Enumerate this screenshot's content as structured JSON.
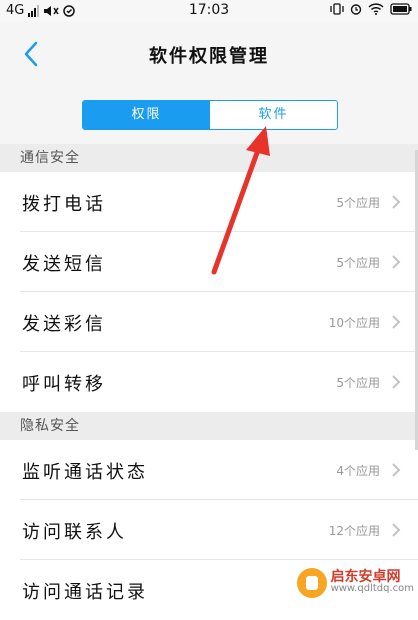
{
  "status_bar": {
    "network": "4G",
    "time": "17:03"
  },
  "header": {
    "title": "软件权限管理"
  },
  "tabs": [
    {
      "label": "权限",
      "active": true
    },
    {
      "label": "软件",
      "active": false
    }
  ],
  "sections": [
    {
      "title": "通信安全",
      "items": [
        {
          "label": "拨打电话",
          "count": "5个应用"
        },
        {
          "label": "发送短信",
          "count": "5个应用"
        },
        {
          "label": "发送彩信",
          "count": "10个应用"
        },
        {
          "label": "呼叫转移",
          "count": "5个应用"
        }
      ]
    },
    {
      "title": "隐私安全",
      "items": [
        {
          "label": "监听通话状态",
          "count": "4个应用"
        },
        {
          "label": "访问联系人",
          "count": "12个应用"
        },
        {
          "label": "访问通话记录",
          "count": ""
        }
      ]
    }
  ],
  "watermark": {
    "name": "启东安卓网",
    "url": "www.qdltdq.com"
  },
  "colors": {
    "accent": "#1a9cf0",
    "annotation_arrow": "#e8332a"
  }
}
